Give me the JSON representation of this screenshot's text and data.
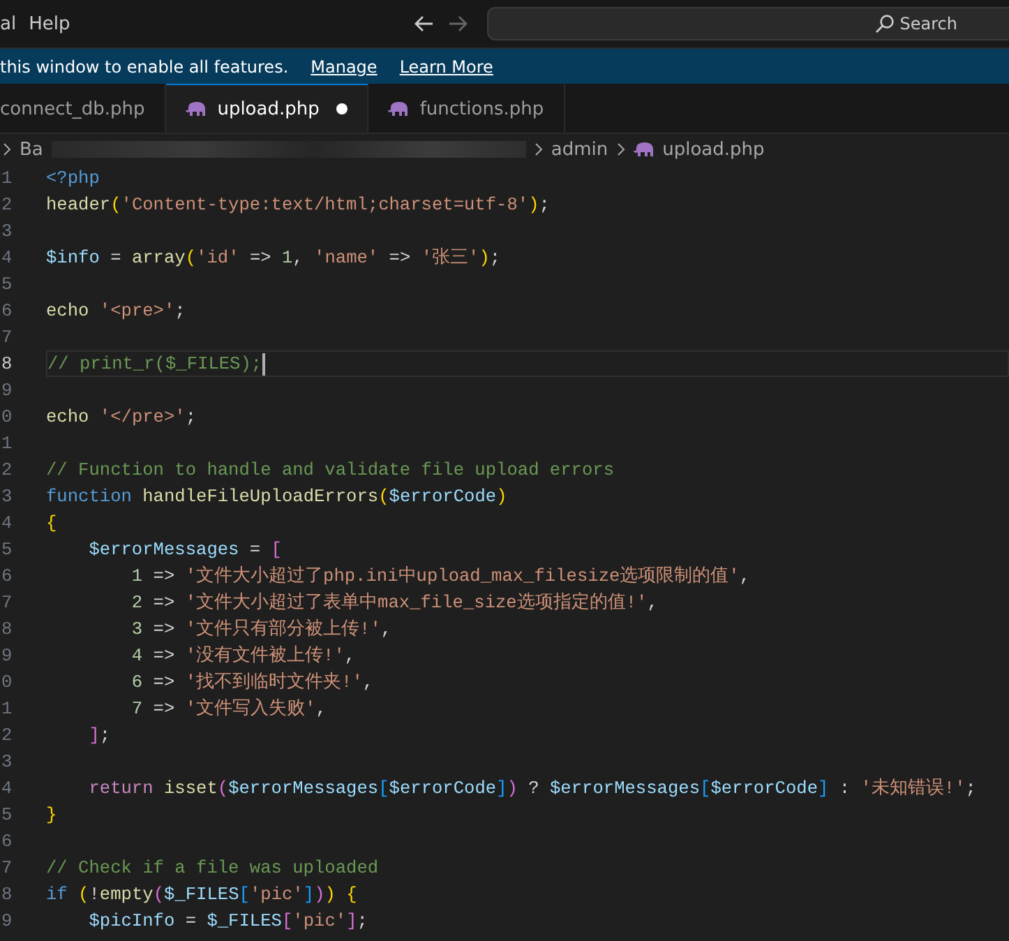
{
  "menu": [
    "al",
    "Help"
  ],
  "search": {
    "placeholder": "Search"
  },
  "banner": {
    "text": "this window to enable all features.",
    "links": [
      "Manage",
      "Learn More"
    ]
  },
  "tabs": [
    {
      "label": "connect_db.php",
      "selected": false,
      "modified": false,
      "icon": false
    },
    {
      "label": "upload.php",
      "selected": true,
      "modified": true,
      "icon": true
    },
    {
      "label": "functions.php",
      "selected": false,
      "modified": false,
      "icon": true
    }
  ],
  "breadcrumb": {
    "lead": "Ba",
    "items": [
      {
        "label": "admin",
        "icon": false
      },
      {
        "label": "upload.php",
        "icon": true
      }
    ]
  },
  "lines": [
    {
      "number": "1",
      "current": false,
      "tokens": [
        {
          "kind": "kw",
          "text": "<?php"
        }
      ]
    },
    {
      "number": "2",
      "current": false,
      "tokens": [
        {
          "kind": "fn",
          "text": "header"
        },
        {
          "kind": "b1",
          "text": "("
        },
        {
          "kind": "str",
          "text": "'Content-type:text/html;charset=utf-8'"
        },
        {
          "kind": "b1",
          "text": ")"
        },
        {
          "kind": "p",
          "text": ";"
        }
      ]
    },
    {
      "number": "3",
      "current": false
    },
    {
      "number": "4",
      "current": false,
      "tokens": [
        {
          "kind": "var",
          "text": "$info"
        },
        {
          "kind": "p",
          "text": " = "
        },
        {
          "kind": "fn",
          "text": "array"
        },
        {
          "kind": "b1",
          "text": "("
        },
        {
          "kind": "str",
          "text": "'id'"
        },
        {
          "kind": "p",
          "text": " => "
        },
        {
          "kind": "num",
          "text": "1"
        },
        {
          "kind": "p",
          "text": ", "
        },
        {
          "kind": "str",
          "text": "'name'"
        },
        {
          "kind": "p",
          "text": " => "
        },
        {
          "kind": "str",
          "text": "'张三'"
        },
        {
          "kind": "b1",
          "text": ")"
        },
        {
          "kind": "p",
          "text": ";"
        }
      ]
    },
    {
      "number": "5",
      "current": false
    },
    {
      "number": "6",
      "current": false,
      "tokens": [
        {
          "kind": "fn",
          "text": "echo "
        },
        {
          "kind": "str",
          "text": "'<pre>'"
        },
        {
          "kind": "p",
          "text": ";"
        }
      ]
    },
    {
      "number": "7",
      "current": false
    },
    {
      "number": "8",
      "current": true,
      "tokens": [
        {
          "kind": "com",
          "text": "// print_r($_FILES);"
        }
      ]
    },
    {
      "number": "9",
      "current": false
    },
    {
      "number": "0",
      "current": false,
      "tokens": [
        {
          "kind": "fn",
          "text": "echo "
        },
        {
          "kind": "str",
          "text": "'</pre>'"
        },
        {
          "kind": "p",
          "text": ";"
        }
      ]
    },
    {
      "number": "1",
      "current": false
    },
    {
      "number": "2",
      "current": false,
      "tokens": [
        {
          "kind": "com",
          "text": "// Function to handle and validate file upload errors"
        }
      ]
    },
    {
      "number": "3",
      "current": false,
      "tokens": [
        {
          "kind": "kw",
          "text": "function "
        },
        {
          "kind": "fn",
          "text": "handleFileUploadErrors"
        },
        {
          "kind": "b1",
          "text": "("
        },
        {
          "kind": "var",
          "text": "$errorCode"
        },
        {
          "kind": "b1",
          "text": ")"
        }
      ]
    },
    {
      "number": "4",
      "current": false,
      "tokens": [
        {
          "kind": "b1",
          "text": "{"
        }
      ]
    },
    {
      "number": "5",
      "current": false,
      "tokens": [
        {
          "kind": "var",
          "text": "    $errorMessages"
        },
        {
          "kind": "p",
          "text": " = "
        },
        {
          "kind": "b2",
          "text": "["
        }
      ]
    },
    {
      "number": "6",
      "current": false,
      "tokens": [
        {
          "kind": "num",
          "text": "        1"
        },
        {
          "kind": "p",
          "text": " => "
        },
        {
          "kind": "str",
          "text": "'文件大小超过了php.ini中upload_max_filesize选项限制的值'"
        },
        {
          "kind": "p",
          "text": ","
        }
      ]
    },
    {
      "number": "7",
      "current": false,
      "tokens": [
        {
          "kind": "num",
          "text": "        2"
        },
        {
          "kind": "p",
          "text": " => "
        },
        {
          "kind": "str",
          "text": "'文件大小超过了表单中max_file_size选项指定的值!'"
        },
        {
          "kind": "p",
          "text": ","
        }
      ]
    },
    {
      "number": "8",
      "current": false,
      "tokens": [
        {
          "kind": "num",
          "text": "        3"
        },
        {
          "kind": "p",
          "text": " => "
        },
        {
          "kind": "str",
          "text": "'文件只有部分被上传!'"
        },
        {
          "kind": "p",
          "text": ","
        }
      ]
    },
    {
      "number": "9",
      "current": false,
      "tokens": [
        {
          "kind": "num",
          "text": "        4"
        },
        {
          "kind": "p",
          "text": " => "
        },
        {
          "kind": "str",
          "text": "'没有文件被上传!'"
        },
        {
          "kind": "p",
          "text": ","
        }
      ]
    },
    {
      "number": "0",
      "current": false,
      "tokens": [
        {
          "kind": "num",
          "text": "        6"
        },
        {
          "kind": "p",
          "text": " => "
        },
        {
          "kind": "str",
          "text": "'找不到临时文件夹!'"
        },
        {
          "kind": "p",
          "text": ","
        }
      ]
    },
    {
      "number": "1",
      "current": false,
      "tokens": [
        {
          "kind": "num",
          "text": "        7"
        },
        {
          "kind": "p",
          "text": " => "
        },
        {
          "kind": "str",
          "text": "'文件写入失败'"
        },
        {
          "kind": "p",
          "text": ","
        }
      ]
    },
    {
      "number": "2",
      "current": false,
      "tokens": [
        {
          "kind": "b2",
          "text": "    ]"
        },
        {
          "kind": "p",
          "text": ";"
        }
      ]
    },
    {
      "number": "3",
      "current": false
    },
    {
      "number": "4",
      "current": false,
      "tokens": [
        {
          "kind": "ctl",
          "text": "    return "
        },
        {
          "kind": "fn",
          "text": "isset"
        },
        {
          "kind": "b2",
          "text": "("
        },
        {
          "kind": "var",
          "text": "$errorMessages"
        },
        {
          "kind": "b3",
          "text": "["
        },
        {
          "kind": "var",
          "text": "$errorCode"
        },
        {
          "kind": "b3",
          "text": "]"
        },
        {
          "kind": "b2",
          "text": ")"
        },
        {
          "kind": "p",
          "text": " ? "
        },
        {
          "kind": "var",
          "text": "$errorMessages"
        },
        {
          "kind": "b3",
          "text": "["
        },
        {
          "kind": "var",
          "text": "$errorCode"
        },
        {
          "kind": "b3",
          "text": "]"
        },
        {
          "kind": "p",
          "text": " : "
        },
        {
          "kind": "str",
          "text": "'未知错误!'"
        },
        {
          "kind": "p",
          "text": ";"
        }
      ]
    },
    {
      "number": "5",
      "current": false,
      "tokens": [
        {
          "kind": "b1",
          "text": "}"
        }
      ]
    },
    {
      "number": "6",
      "current": false
    },
    {
      "number": "7",
      "current": false,
      "tokens": [
        {
          "kind": "com",
          "text": "// Check if a file was uploaded"
        }
      ]
    },
    {
      "number": "8",
      "current": false,
      "tokens": [
        {
          "kind": "kw",
          "text": "if "
        },
        {
          "kind": "b1",
          "text": "("
        },
        {
          "kind": "p",
          "text": "!"
        },
        {
          "kind": "fn",
          "text": "empty"
        },
        {
          "kind": "b2",
          "text": "("
        },
        {
          "kind": "var",
          "text": "$_FILES"
        },
        {
          "kind": "b3",
          "text": "["
        },
        {
          "kind": "str",
          "text": "'pic'"
        },
        {
          "kind": "b3",
          "text": "]"
        },
        {
          "kind": "b2",
          "text": ")"
        },
        {
          "kind": "b1",
          "text": ") {"
        }
      ]
    },
    {
      "number": "9",
      "current": false,
      "tokens": [
        {
          "kind": "var",
          "text": "    $picInfo"
        },
        {
          "kind": "p",
          "text": " = "
        },
        {
          "kind": "var",
          "text": "$_FILES"
        },
        {
          "kind": "b2",
          "text": "["
        },
        {
          "kind": "str",
          "text": "'pic'"
        },
        {
          "kind": "b2",
          "text": "]"
        },
        {
          "kind": "p",
          "text": ";"
        }
      ]
    }
  ]
}
